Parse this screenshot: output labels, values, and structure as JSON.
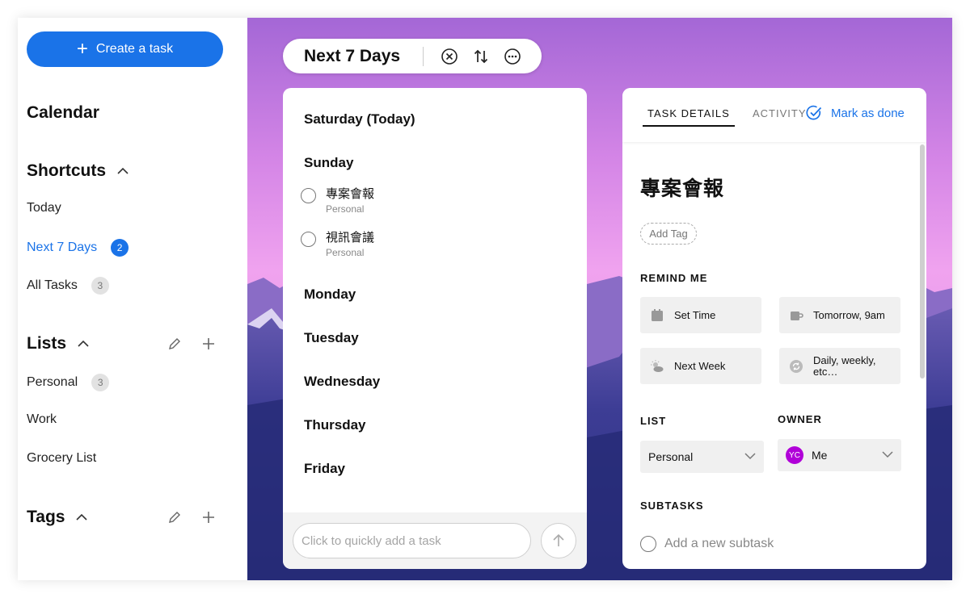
{
  "sidebar": {
    "create_label": "Create a task",
    "calendar_label": "Calendar",
    "shortcuts_label": "Shortcuts",
    "shortcuts": [
      {
        "label": "Today",
        "count": ""
      },
      {
        "label": "Next 7 Days",
        "count": "2"
      },
      {
        "label": "All Tasks",
        "count": "3"
      }
    ],
    "lists_label": "Lists",
    "lists": [
      {
        "label": "Personal",
        "count": "3"
      },
      {
        "label": "Work",
        "count": ""
      },
      {
        "label": "Grocery List",
        "count": ""
      }
    ],
    "tags_label": "Tags"
  },
  "header": {
    "title": "Next 7 Days"
  },
  "planner": {
    "days": [
      {
        "label": "Saturday (Today)"
      },
      {
        "label": "Sunday"
      },
      {
        "label": "Monday"
      },
      {
        "label": "Tuesday"
      },
      {
        "label": "Wednesday"
      },
      {
        "label": "Thursday"
      },
      {
        "label": "Friday"
      }
    ],
    "sunday_tasks": [
      {
        "name": "專案會報",
        "list": "Personal"
      },
      {
        "name": "視訊會議",
        "list": "Personal"
      }
    ],
    "quick_add_placeholder": "Click to quickly add a task"
  },
  "detail": {
    "tab_details": "TASK DETAILS",
    "tab_activity": "ACTIVITY",
    "mark_done": "Mark as done",
    "title": "專案會報",
    "add_tag": "Add Tag",
    "remind_label": "REMIND ME",
    "remind_options": [
      {
        "label": "Set Time",
        "icon": "calendar-icon"
      },
      {
        "label": "Tomorrow, 9am",
        "icon": "coffee-cup-icon"
      },
      {
        "label": "Next Week",
        "icon": "sun-cloud-icon"
      },
      {
        "label": "Daily, weekly, etc…",
        "icon": "repeat-icon"
      }
    ],
    "list_label": "LIST",
    "list_value": "Personal",
    "owner_label": "OWNER",
    "owner_initials": "YC",
    "owner_value": "Me",
    "subtasks_label": "SUBTASKS",
    "subtask_placeholder": "Add a new subtask"
  },
  "colors": {
    "accent": "#1a73e8",
    "avatar": "#b000d8",
    "sky_top": "#a96bd8",
    "sky_glow": "#f3a6f0",
    "mountain": "#3a3b8f"
  }
}
